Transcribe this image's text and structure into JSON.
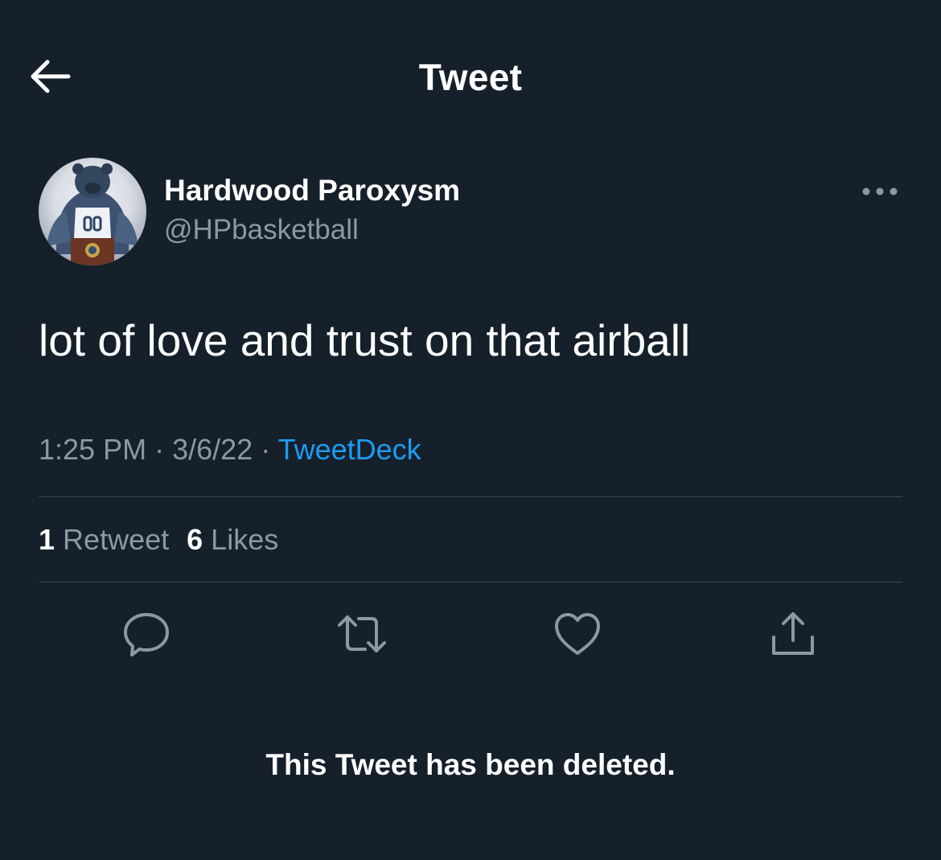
{
  "header": {
    "title": "Tweet",
    "back_icon": "arrow-left-icon"
  },
  "author": {
    "name": "Hardwood Paroxysm",
    "handle": "@HPbasketball",
    "avatar_icon": "grizzlies-mascot-avatar"
  },
  "tweet": {
    "text": "lot of love and trust on that airball",
    "time": "1:25 PM",
    "date": "3/6/22",
    "separator": "·",
    "source": "TweetDeck"
  },
  "stats": {
    "retweets_count": "1",
    "retweets_label": "Retweet",
    "likes_count": "6",
    "likes_label": "Likes"
  },
  "actions": [
    {
      "name": "reply",
      "icon": "reply-icon"
    },
    {
      "name": "retweet",
      "icon": "retweet-icon"
    },
    {
      "name": "like",
      "icon": "heart-icon"
    },
    {
      "name": "share",
      "icon": "share-icon"
    }
  ],
  "notice": {
    "deleted_text": "This Tweet has been deleted."
  },
  "colors": {
    "background": "#15202b",
    "text_primary": "#ffffff",
    "text_secondary": "#8b98a5",
    "link": "#1d9bf0",
    "divider": "#38444d"
  }
}
